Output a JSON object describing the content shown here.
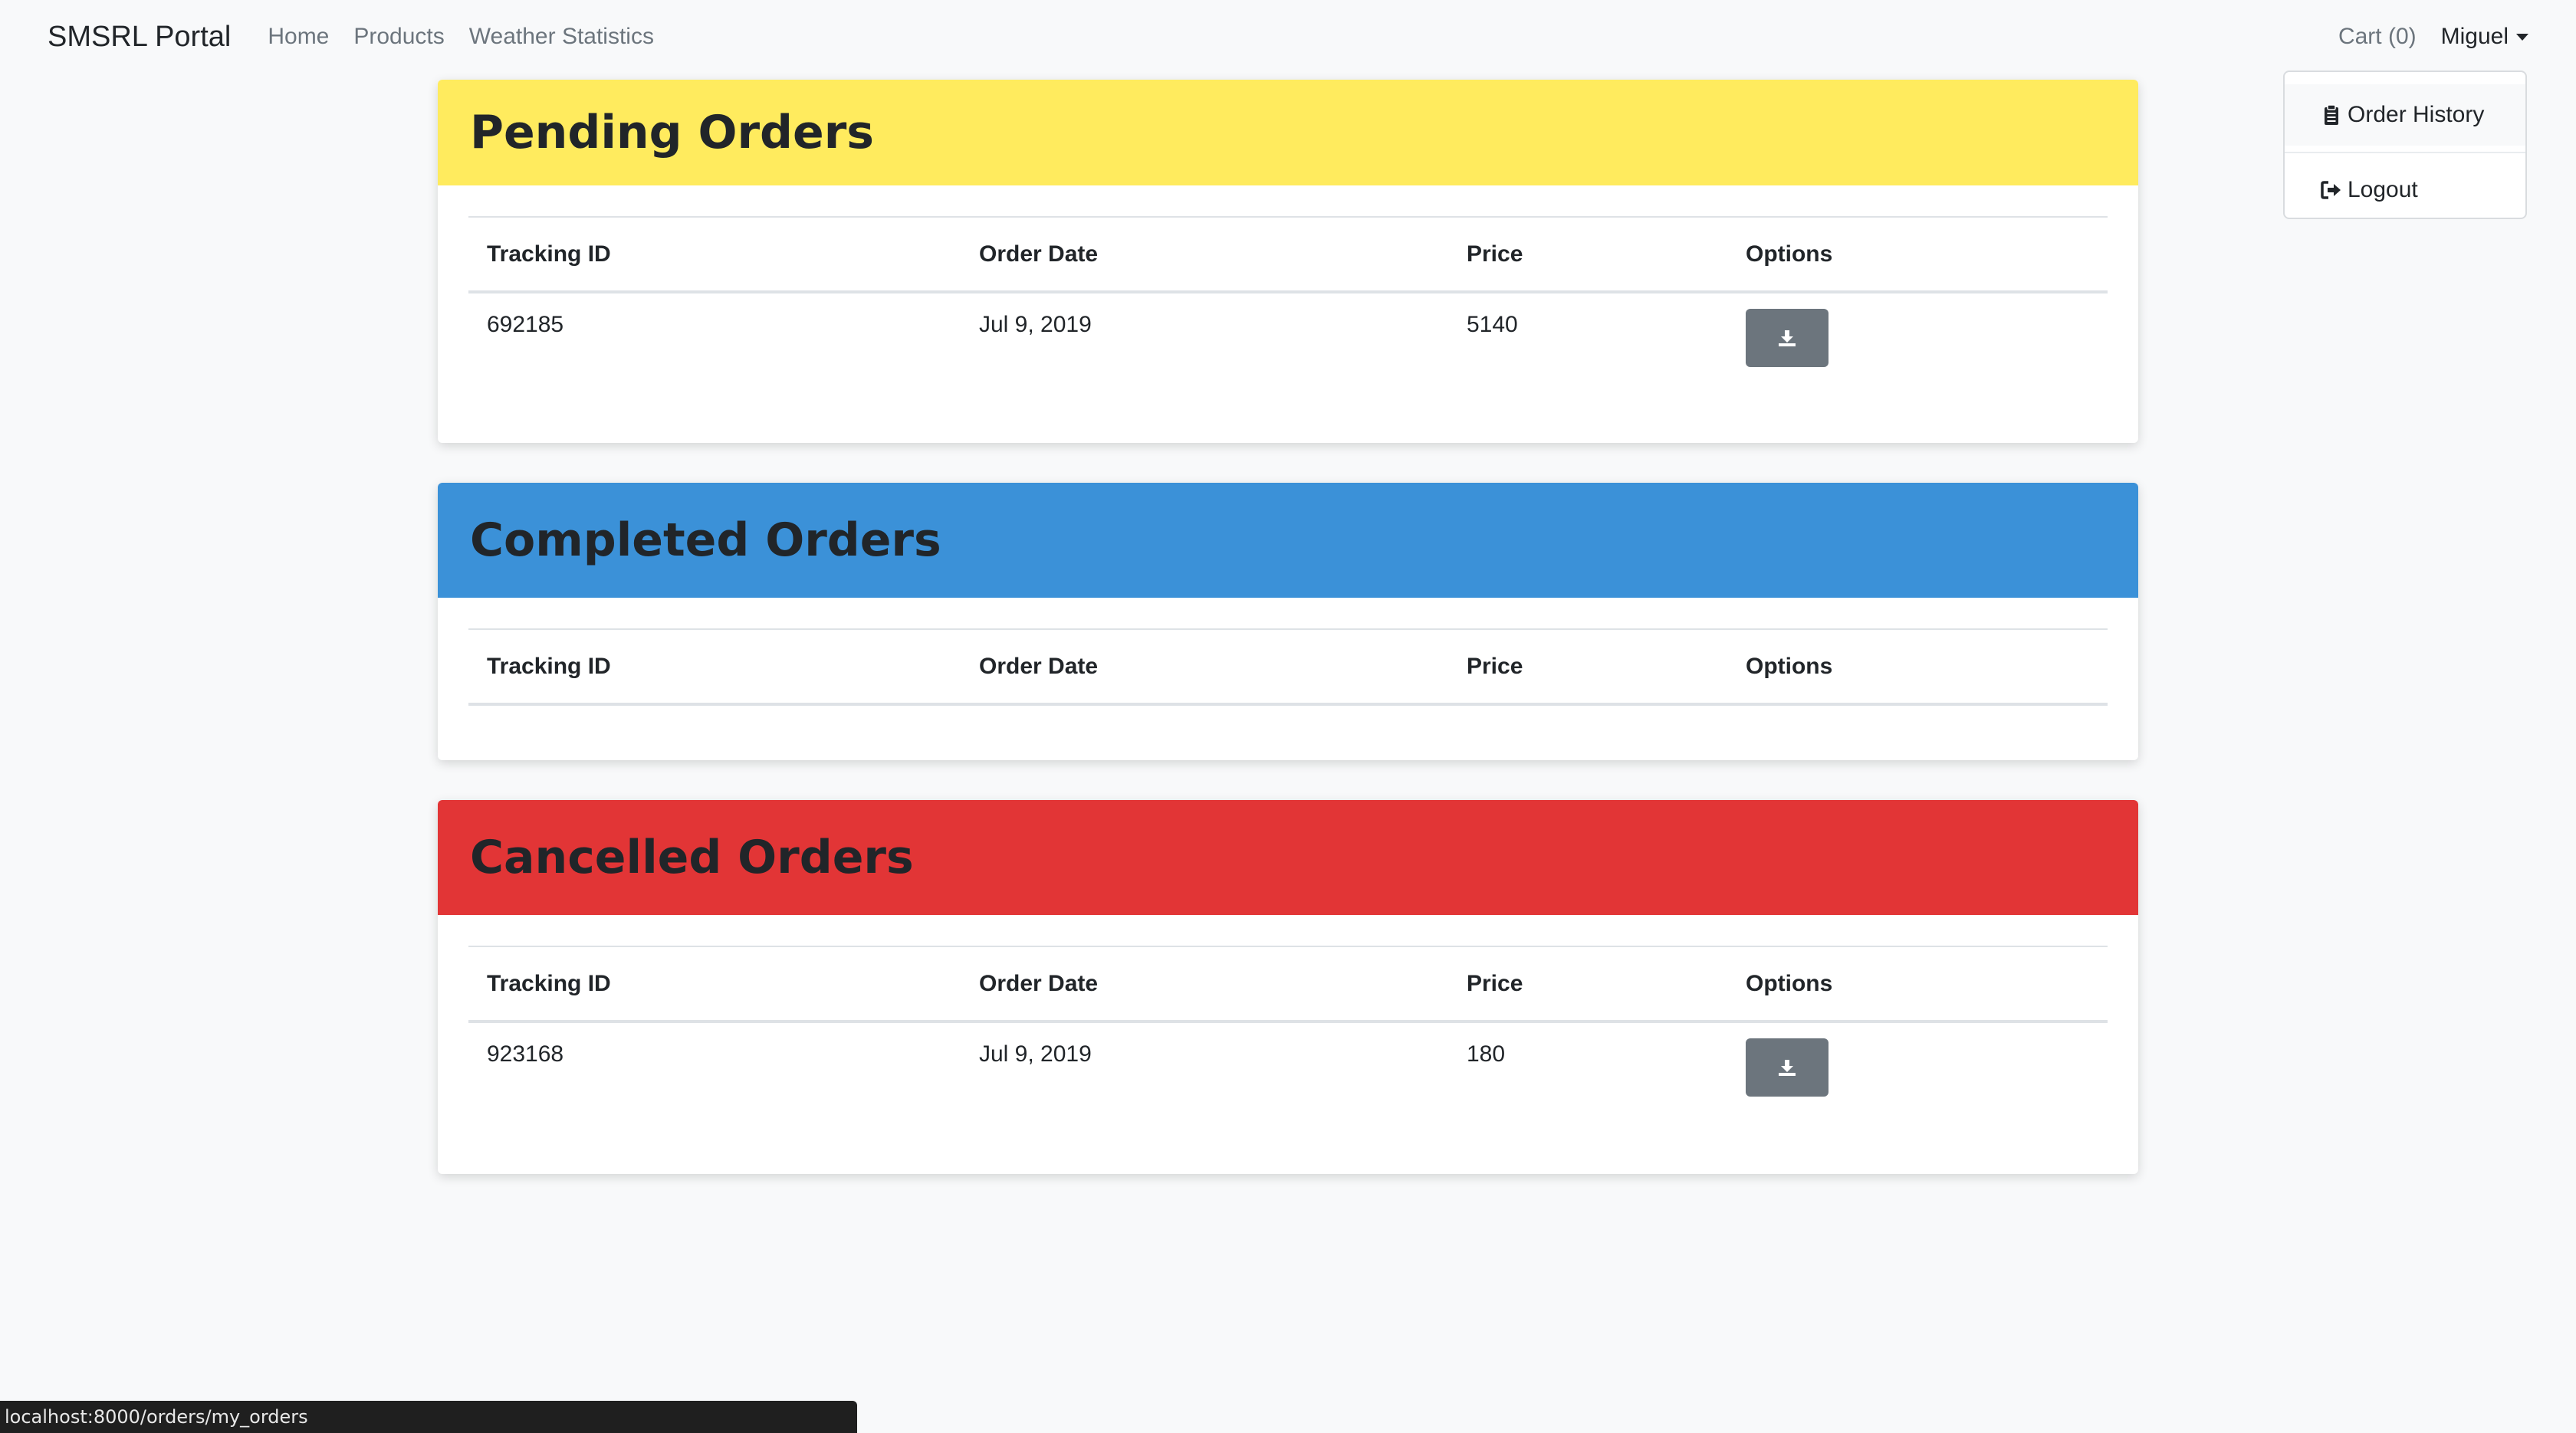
{
  "navbar": {
    "brand": "SMSRL Portal",
    "links": [
      "Home",
      "Products",
      "Weather Statistics"
    ],
    "cart": "Cart (0)",
    "user": "Miguel"
  },
  "dropdown": {
    "items": [
      {
        "label": "Order History",
        "icon": "clipboard-icon"
      },
      {
        "label": "Logout",
        "icon": "sign-out-icon"
      }
    ]
  },
  "columns": [
    "Tracking ID",
    "Order Date",
    "Price",
    "Options"
  ],
  "sections": {
    "pending": {
      "title": "Pending Orders",
      "color": "#ffeb5e",
      "rows": [
        {
          "tracking_id": "692185",
          "order_date": "Jul 9, 2019",
          "price": "5140"
        }
      ]
    },
    "completed": {
      "title": "Completed Orders",
      "color": "#3b91d8",
      "rows": []
    },
    "cancelled": {
      "title": "Cancelled Orders",
      "color": "#e23536",
      "rows": [
        {
          "tracking_id": "923168",
          "order_date": "Jul 9, 2019",
          "price": "180"
        }
      ]
    }
  },
  "statusbar": {
    "url": "localhost:8000/orders/my_orders"
  }
}
